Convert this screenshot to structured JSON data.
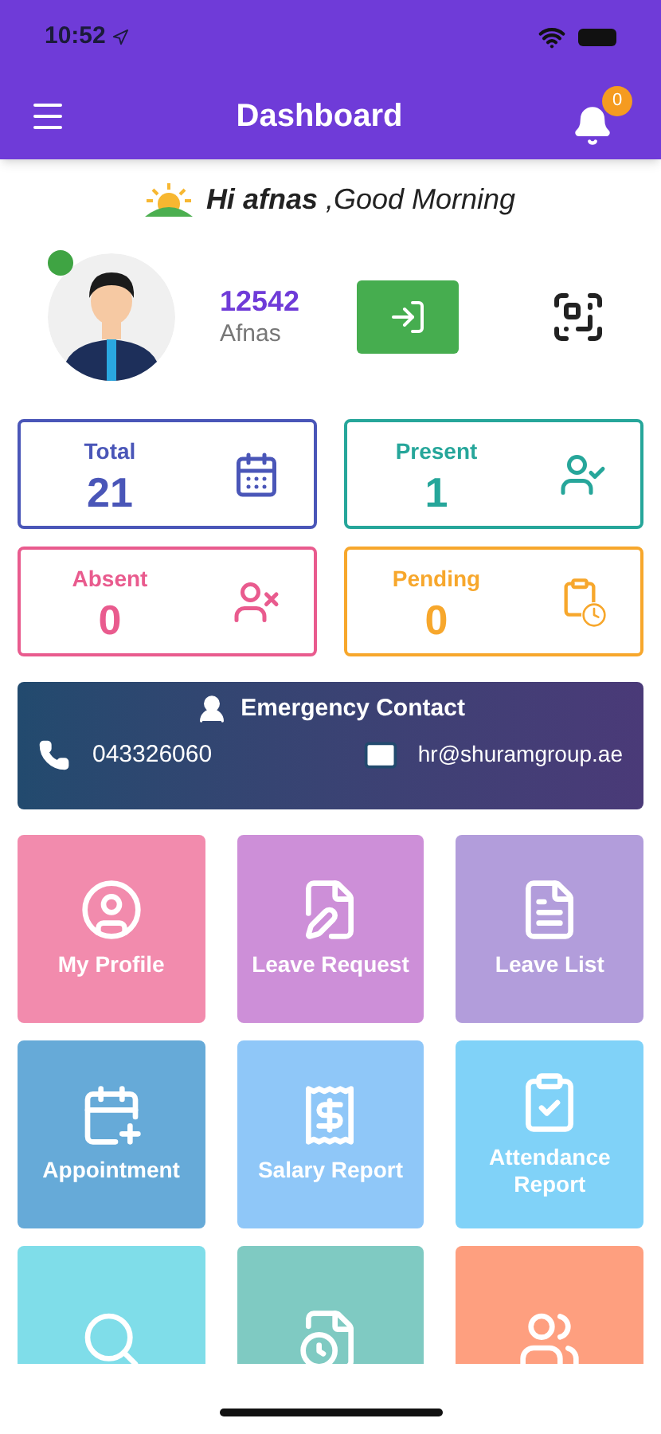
{
  "status_bar": {
    "time": "10:52"
  },
  "header": {
    "title": "Dashboard",
    "notification_count": "0"
  },
  "greeting": {
    "name": "Hi afnas",
    "message": ",Good Morning"
  },
  "profile": {
    "id": "12542",
    "name": "Afnas",
    "online": true
  },
  "stats": [
    {
      "label": "Total",
      "value": "21",
      "color": "#4a56b8",
      "kind": "calendar"
    },
    {
      "label": "Present",
      "value": "1",
      "color": "#26a69a",
      "kind": "present"
    },
    {
      "label": "Absent",
      "value": "0",
      "color": "#e95b8e",
      "kind": "absent"
    },
    {
      "label": "Pending",
      "value": "0",
      "color": "#f7a72c",
      "kind": "pending"
    }
  ],
  "emergency_contact": {
    "title": "Emergency Contact",
    "phone": "043326060",
    "email": "hr@shuramgroup.ae"
  },
  "tiles": [
    {
      "label": "My Profile",
      "color": "#f28bad",
      "kind": "profile"
    },
    {
      "label": "Leave Request",
      "color": "#cd8fd8",
      "kind": "leave-request"
    },
    {
      "label": "Leave List",
      "color": "#b29ddb",
      "kind": "leave-list"
    },
    {
      "label": "Appointment",
      "color": "#66aad8",
      "kind": "appointment"
    },
    {
      "label": "Salary Report",
      "color": "#8fc7f8",
      "kind": "salary"
    },
    {
      "label": "Attendance Report",
      "color": "#80d2f8",
      "kind": "attendance"
    },
    {
      "color": "#7fdde9",
      "kind": "employee"
    },
    {
      "color": "#7fcac2",
      "kind": "timesheet"
    },
    {
      "color": "#fe9f7f",
      "kind": "team"
    }
  ]
}
